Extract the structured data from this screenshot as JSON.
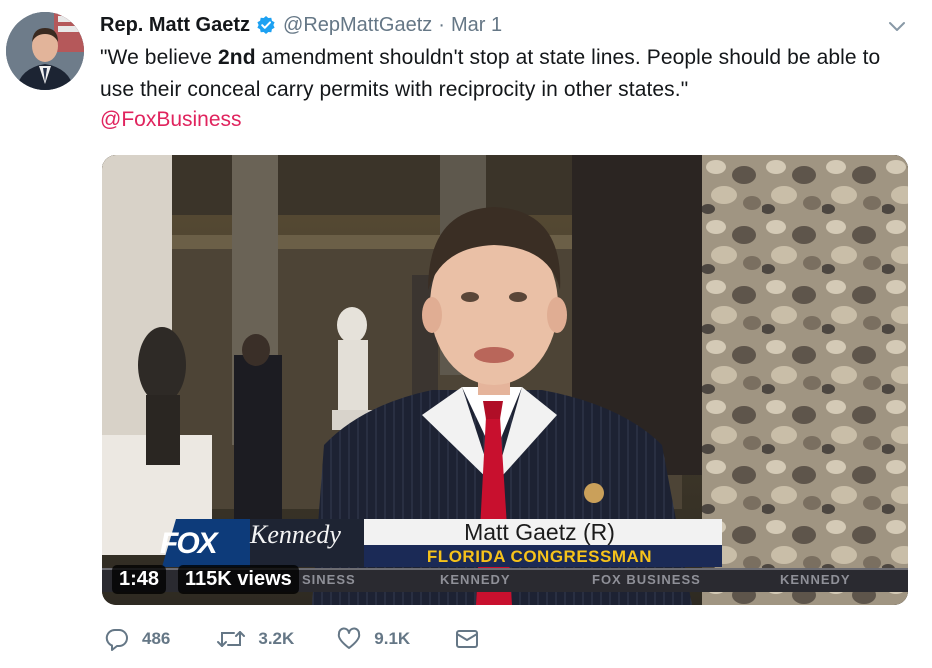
{
  "tweet": {
    "author_name": "Rep. Matt Gaetz",
    "author_handle": "@RepMattGaetz",
    "separator": "·",
    "date": "Mar 1",
    "text_before_bold": "\"We believe ",
    "text_bold": "2nd",
    "text_after_bold": " amendment shouldn't stop at state lines. People should be able to use their conceal carry permits with reciprocity in other states.\"",
    "mention": "@FoxBusiness",
    "mention_color": "#e0245e"
  },
  "video": {
    "duration": "1:48",
    "views": "115K views",
    "channel_logo": "FOX",
    "show_logo": "Kennedy",
    "lower_third_name": "Matt Gaetz (R)",
    "lower_third_title": "FLORIDA CONGRESSMAN",
    "ticker": [
      "SINESS",
      "KENNEDY",
      "FOX BUSINESS",
      "KENNEDY"
    ]
  },
  "actions": {
    "replies": "486",
    "retweets": "3.2K",
    "likes": "9.1K"
  },
  "icons": {
    "verified": "verified-badge-icon",
    "caret": "chevron-down-icon",
    "reply": "reply-icon",
    "retweet": "retweet-icon",
    "like": "heart-icon",
    "dm": "envelope-icon"
  },
  "colors": {
    "verified_blue": "#1da1f2",
    "secondary_text": "#657786",
    "lower_third_title": "#f6c21a"
  }
}
